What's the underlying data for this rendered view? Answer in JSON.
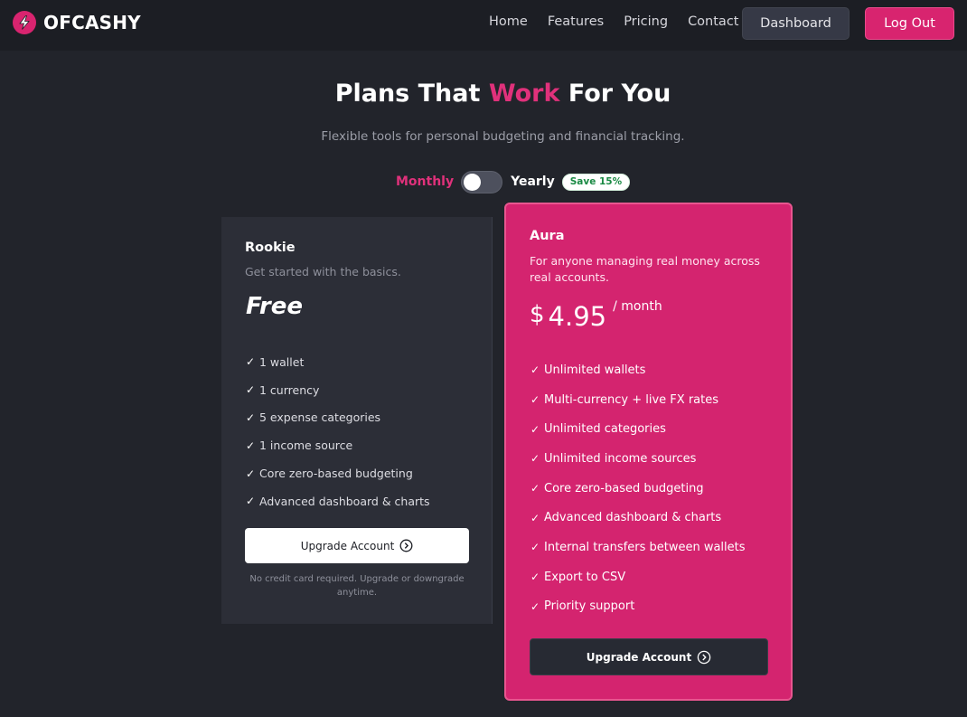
{
  "brand": {
    "name": "OFCASHY",
    "logo_icon": "lightning-bolt-icon",
    "accent_color": "#d8246f"
  },
  "nav": {
    "links": [
      "Home",
      "Features",
      "Pricing",
      "Contact"
    ],
    "dashboard_label": "Dashboard",
    "logout_label": "Log Out"
  },
  "hero": {
    "title_before": "Plans That ",
    "title_accent": "Work",
    "title_after": " For You",
    "subtitle": "Flexible tools for personal budgeting and financial tracking."
  },
  "billing": {
    "monthly_label": "Monthly",
    "yearly_label": "Yearly",
    "save_badge": "Save 15%",
    "selected": "Monthly"
  },
  "plans": [
    {
      "name": "Rookie",
      "description": "Get started with the basics.",
      "price": "Free",
      "features": [
        "1 wallet",
        "1 currency",
        "5 expense categories",
        "1 income source",
        "Core zero-based budgeting",
        "Advanced dashboard & charts"
      ],
      "cta_label": "Upgrade Account",
      "note": "No credit card required. Upgrade or downgrade anytime."
    },
    {
      "name": "Aura",
      "description": "For anyone managing real money across real accounts.",
      "currency": "$",
      "price": "4.95",
      "period": "/ month",
      "features": [
        "Unlimited wallets",
        "Multi-currency + live FX rates",
        "Unlimited categories",
        "Unlimited income sources",
        "Core zero-based budgeting",
        "Advanced dashboard & charts",
        "Internal transfers between wallets",
        "Export to CSV",
        "Priority support"
      ],
      "cta_label": "Upgrade Account"
    }
  ]
}
